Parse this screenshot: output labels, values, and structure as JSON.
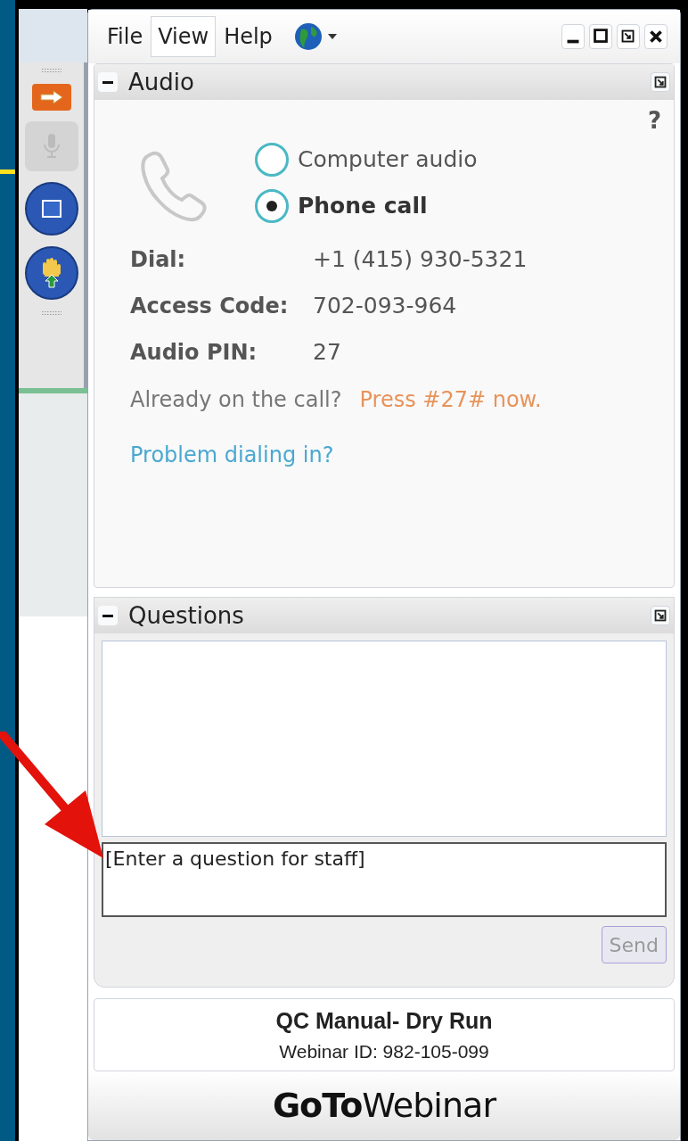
{
  "menu": [
    {
      "label": "File",
      "selected": false
    },
    {
      "label": "View",
      "selected": true
    },
    {
      "label": "Help",
      "selected": false
    }
  ],
  "audio": {
    "title": "Audio",
    "help": "?",
    "options": [
      {
        "label": "Computer audio",
        "selected": false
      },
      {
        "label": "Phone call",
        "selected": true
      }
    ],
    "details": [
      {
        "label": "Dial:",
        "value": "+1 (415) 930-5321"
      },
      {
        "label": "Access Code:",
        "value": "702-093-964"
      },
      {
        "label": "Audio PIN:",
        "value": "27"
      }
    ],
    "already": "Already on the call?",
    "press": "Press #27# now.",
    "problem": "Problem dialing in?"
  },
  "questions": {
    "title": "Questions",
    "placeholder": "[Enter a question for staff]",
    "send": "Send"
  },
  "webinar": {
    "title": "QC Manual- Dry Run",
    "id": "Webinar ID: 982-105-099",
    "logo": "**GoTo**Webinar"
  }
}
